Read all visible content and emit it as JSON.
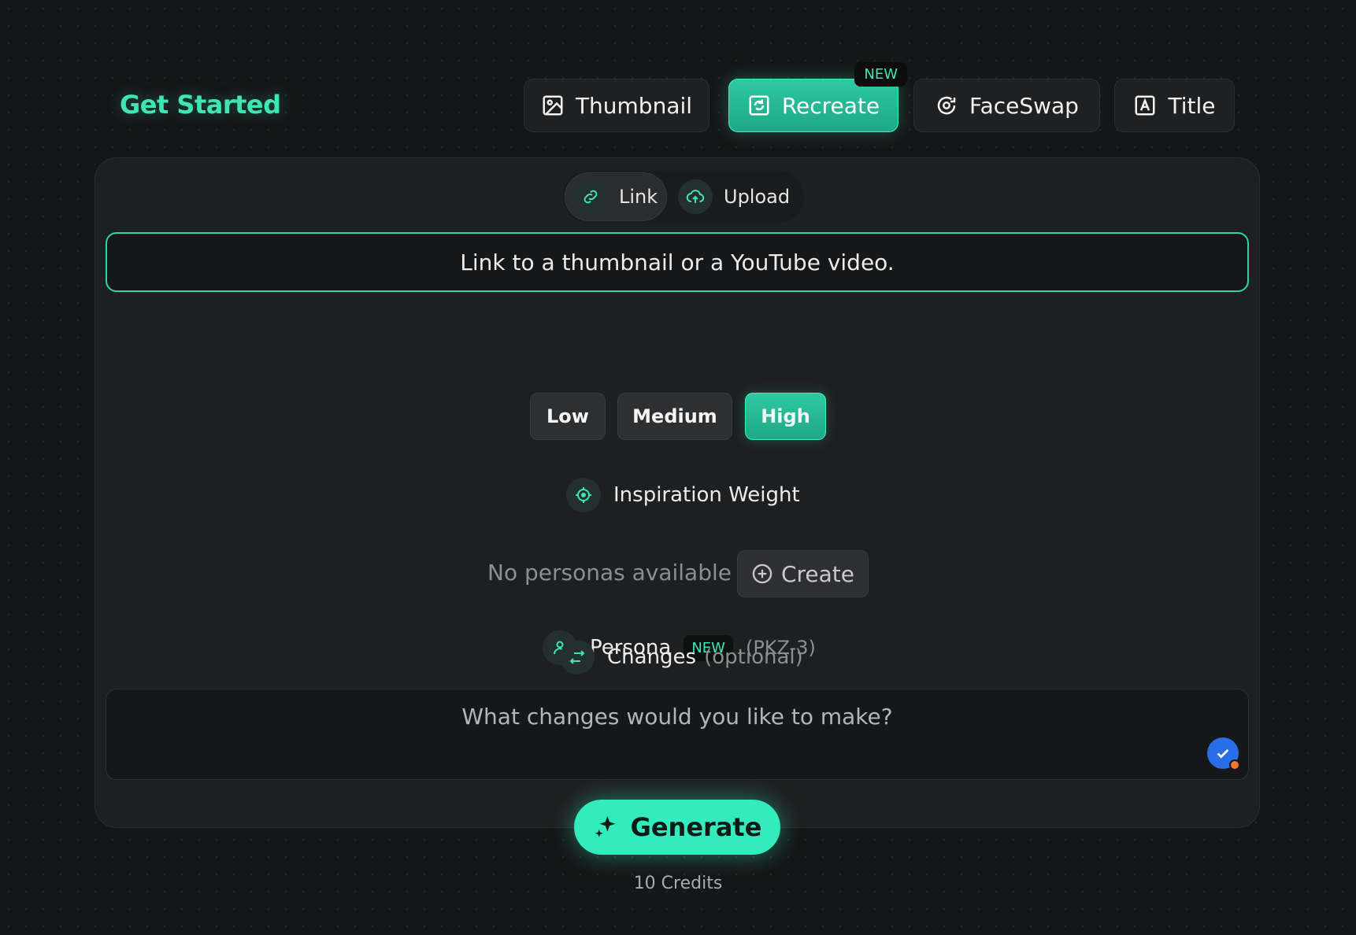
{
  "header": {
    "title": "Get Started"
  },
  "tabs": [
    {
      "label": "Thumbnail",
      "icon": "image-icon"
    },
    {
      "label": "Recreate",
      "icon": "recreate-icon",
      "badge": "NEW",
      "active": true
    },
    {
      "label": "FaceSwap",
      "icon": "faceswap-icon"
    },
    {
      "label": "Title",
      "icon": "title-icon"
    }
  ],
  "source": {
    "link_label": "Link",
    "upload_label": "Upload",
    "input_placeholder": "Link to a thumbnail or a YouTube video."
  },
  "weight": {
    "label": "Inspiration Weight",
    "options": [
      "Low",
      "Medium",
      "High"
    ],
    "selected": "High"
  },
  "persona": {
    "label": "Persona",
    "badge": "NEW",
    "model": "(PKZ-3)",
    "empty_text": "No personas available",
    "create_label": "Create"
  },
  "changes": {
    "label": "Changes",
    "optional": "(optional)",
    "placeholder": "What changes would you like to make?"
  },
  "generate": {
    "label": "Generate",
    "credits": "10 Credits"
  },
  "colors": {
    "accent": "#34ebbd",
    "background": "#151617",
    "card": "#1e1f20"
  }
}
